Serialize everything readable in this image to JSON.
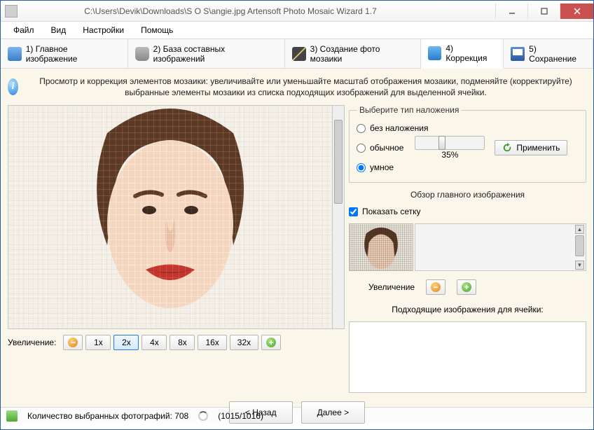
{
  "window": {
    "title": "C:\\Users\\Devik\\Downloads\\S O S\\angie.jpg Artensoft Photo Mosaic Wizard 1.7"
  },
  "menu": {
    "items": [
      "Файл",
      "Вид",
      "Настройки",
      "Помощь"
    ]
  },
  "tabs": {
    "items": [
      {
        "label": "1) Главное изображение"
      },
      {
        "label": "2) База составных изображений"
      },
      {
        "label": "3) Создание фото мозаики"
      },
      {
        "label": "4) Коррекция"
      },
      {
        "label": "5) Сохранение"
      }
    ],
    "active_index": 3
  },
  "info": {
    "text": "Просмотр и коррекция элементов мозаики: увеличивайте или уменьшайте масштаб отображения мозаики, подменяйте (корректируйте) выбранные элементы мозаики из списка подходящих изображений для выделенной ячейки."
  },
  "zoom": {
    "label": "Увеличение:",
    "levels": [
      "1x",
      "2x",
      "4x",
      "8x",
      "16x",
      "32x"
    ],
    "active_index": 1
  },
  "overlay": {
    "legend": "Выберите тип наложения",
    "options": {
      "none": "без наложения",
      "normal": "обычное",
      "smart": "умное"
    },
    "selected": "smart",
    "slider_percent": "35%",
    "slider_value": 35,
    "apply": "Применить"
  },
  "overview": {
    "title": "Обзор главного изображения",
    "show_grid_label": "Показать сетку",
    "show_grid_checked": true,
    "zoom_label": "Увеличение"
  },
  "matching": {
    "title": "Подходящие изображения для ячейки:"
  },
  "nav": {
    "back": "< Назад",
    "next": "Далее >"
  },
  "status": {
    "photos_label": "Количество выбранных фотографий: 708",
    "progress": "(1015/1016)"
  }
}
